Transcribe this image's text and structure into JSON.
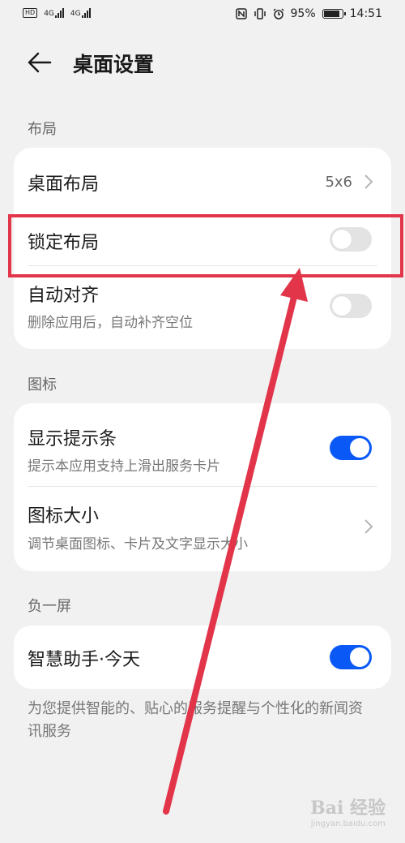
{
  "status_bar": {
    "hd": "HD",
    "signal1": "4G",
    "signal2": "4G",
    "battery_percent": "95%",
    "battery_level": 0.95,
    "time": "14:51",
    "icons": [
      "nfc-icon",
      "vibrate-icon",
      "alarm-icon",
      "battery-icon"
    ]
  },
  "header": {
    "title": "桌面设置"
  },
  "sections": {
    "layout": {
      "label": "布局",
      "items": [
        {
          "title": "桌面布局",
          "value": "5x6"
        },
        {
          "title": "锁定布局",
          "toggle": false
        },
        {
          "title": "自动对齐",
          "subtitle": "删除应用后，自动补齐空位",
          "toggle": false
        }
      ]
    },
    "icons": {
      "label": "图标",
      "items": [
        {
          "title": "显示提示条",
          "subtitle": "提示本应用支持上滑出服务卡片",
          "toggle": true
        },
        {
          "title": "图标大小",
          "subtitle": "调节桌面图标、卡片及文字显示大小"
        }
      ]
    },
    "minus_one": {
      "label": "负一屏",
      "items": [
        {
          "title": "智慧助手·今天",
          "toggle": true
        }
      ]
    }
  },
  "footer_note": "为您提供智能的、贴心的服务提醒与个性化的新闻资讯服务",
  "colors": {
    "accent": "#0a59f7",
    "annotation": "#e2354a",
    "background": "#f1f1f1"
  },
  "watermark": {
    "text": "Bai 经验",
    "sub": "jingyan.baidu.com"
  }
}
